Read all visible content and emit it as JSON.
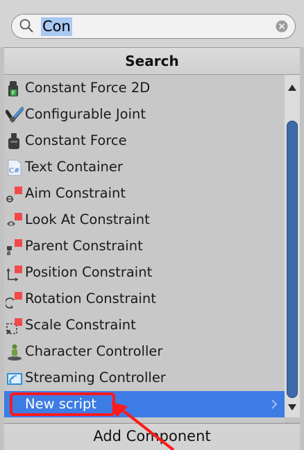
{
  "search": {
    "query": "Con"
  },
  "header": {
    "title": "Search"
  },
  "items": [
    {
      "label": "Constant Force 2D",
      "icon": "constant-force-2d-icon"
    },
    {
      "label": "Configurable Joint",
      "icon": "configurable-joint-icon"
    },
    {
      "label": "Constant Force",
      "icon": "constant-force-icon"
    },
    {
      "label": "Text Container",
      "icon": "csharp-script-icon"
    },
    {
      "label": "Aim Constraint",
      "icon": "aim-constraint-icon"
    },
    {
      "label": "Look At Constraint",
      "icon": "look-at-constraint-icon"
    },
    {
      "label": "Parent Constraint",
      "icon": "parent-constraint-icon"
    },
    {
      "label": "Position Constraint",
      "icon": "position-constraint-icon"
    },
    {
      "label": "Rotation Constraint",
      "icon": "rotation-constraint-icon"
    },
    {
      "label": "Scale Constraint",
      "icon": "scale-constraint-icon"
    },
    {
      "label": "Character Controller",
      "icon": "character-controller-icon"
    },
    {
      "label": "Streaming Controller",
      "icon": "streaming-controller-icon"
    },
    {
      "label": "New script",
      "icon": "",
      "selected": true
    }
  ],
  "footer": {
    "add_component_label": "Add Component"
  },
  "colors": {
    "selection": "#3e7ce5",
    "annotation": "#ff1a1a",
    "scroll_thumb": "#3e6aa8"
  }
}
